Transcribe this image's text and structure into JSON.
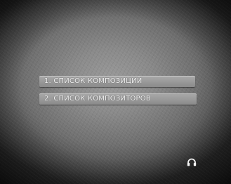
{
  "menu": {
    "items": [
      {
        "label": "1. СПИСОК КОМПОЗИЦИЙ"
      },
      {
        "label": "2. СПИСОК КОМПОЗИТОРОВ"
      }
    ]
  },
  "status": {
    "icon": "headphones-icon"
  },
  "colors": {
    "background_center": "#9a9a9a",
    "background_edge": "#2a2a2a",
    "menu_item_bg": "#9c9c9c",
    "menu_text": "#f2f2f2",
    "icon": "#f4f4f4"
  }
}
